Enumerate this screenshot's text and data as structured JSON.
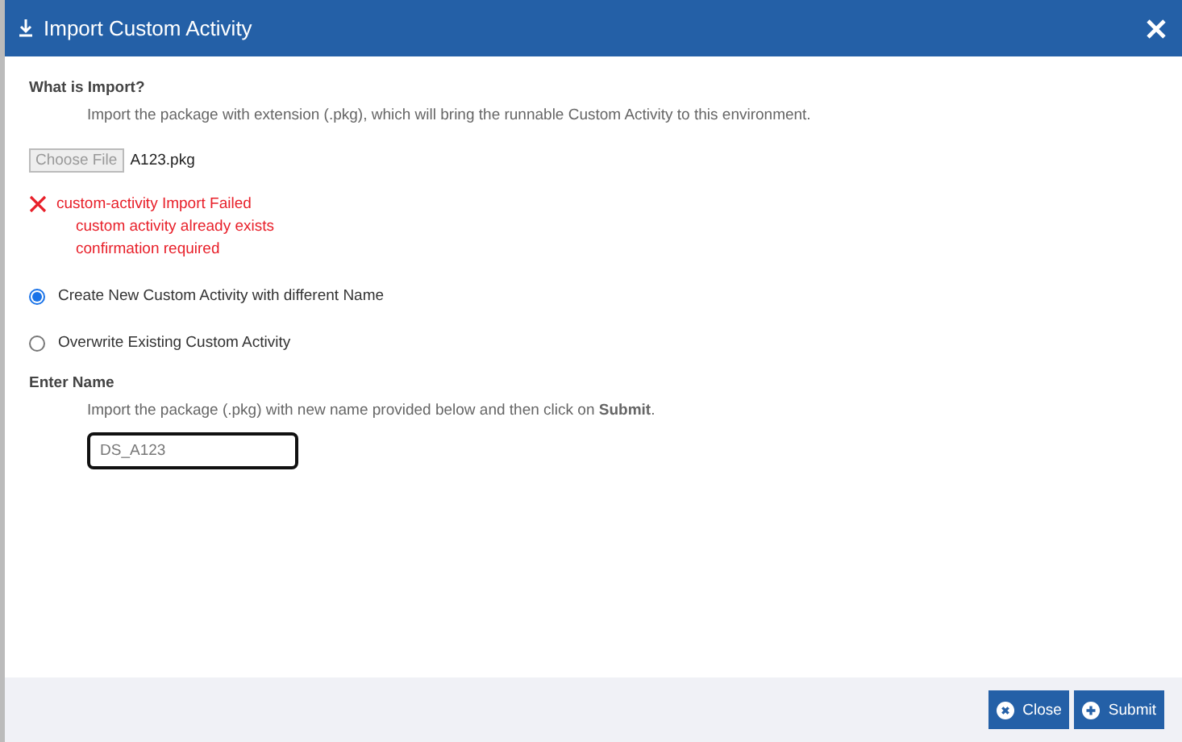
{
  "window": {
    "title": "Import Custom Activity"
  },
  "intro": {
    "heading": "What is Import?",
    "description": "Import the package with extension (.pkg), which will bring the runnable Custom Activity to this environment."
  },
  "file": {
    "button": "Choose File",
    "name": "A123.pkg"
  },
  "error": {
    "title": "custom-activity Import Failed",
    "details": [
      "custom activity already exists",
      "confirmation required"
    ]
  },
  "options": [
    {
      "label": "Create New Custom Activity with different Name",
      "selected": true
    },
    {
      "label": "Overwrite Existing Custom Activity",
      "selected": false
    }
  ],
  "name_section": {
    "heading": "Enter Name",
    "description": "Import the package (.pkg) with new name provided below and then click on **Submit**.",
    "value": "DS_A123"
  },
  "buttons": [
    {
      "kind": "close",
      "label": "Close"
    },
    {
      "kind": "submit",
      "label": "Submit"
    }
  ]
}
